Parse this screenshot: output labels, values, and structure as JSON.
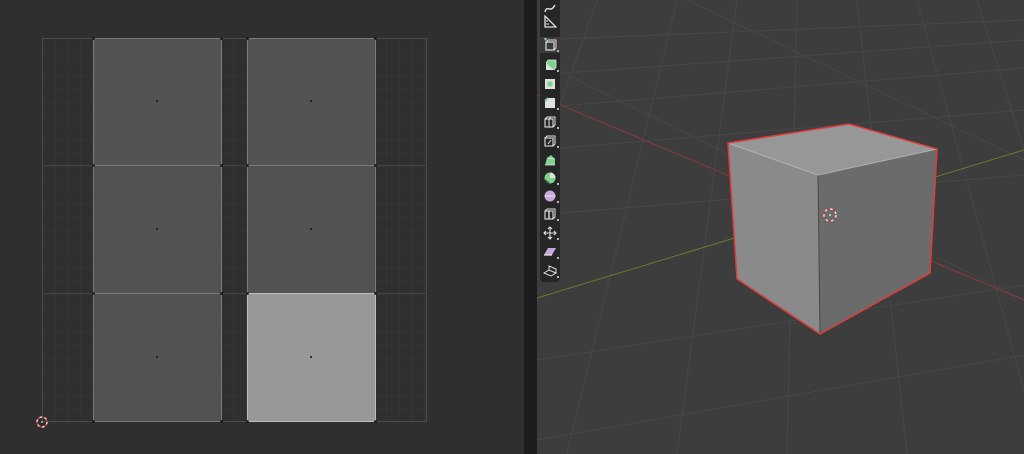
{
  "uv_editor": {
    "islands": 6,
    "selected_island": "bottom-right"
  },
  "viewport": {
    "toolbar": {
      "tools": [
        {
          "name": "annotate-tool",
          "active": false
        },
        {
          "name": "measure-tool",
          "active": false
        },
        {
          "name": "add-cube-tool",
          "active": true
        },
        {
          "name": "extrude-region-tool",
          "active": false
        },
        {
          "name": "inset-faces-tool",
          "active": false
        },
        {
          "name": "bevel-tool",
          "active": false
        },
        {
          "name": "loop-cut-tool",
          "active": false
        },
        {
          "name": "knife-tool",
          "active": false
        },
        {
          "name": "poly-build-tool",
          "active": false
        },
        {
          "name": "spin-tool",
          "active": false
        },
        {
          "name": "smooth-tool",
          "active": false
        },
        {
          "name": "edge-slide-tool",
          "active": false
        },
        {
          "name": "shrink-fatten-tool",
          "active": false
        },
        {
          "name": "shear-tool",
          "active": false
        },
        {
          "name": "rip-region-tool",
          "active": false
        }
      ]
    },
    "colors": {
      "x_axis": "#8a3a3a",
      "y_axis": "#6e7a2e",
      "selection_outline": "#e03c3c",
      "cube_top": "#979797",
      "cube_left": "#8a8a8a",
      "cube_right": "#6b6b6b"
    }
  }
}
